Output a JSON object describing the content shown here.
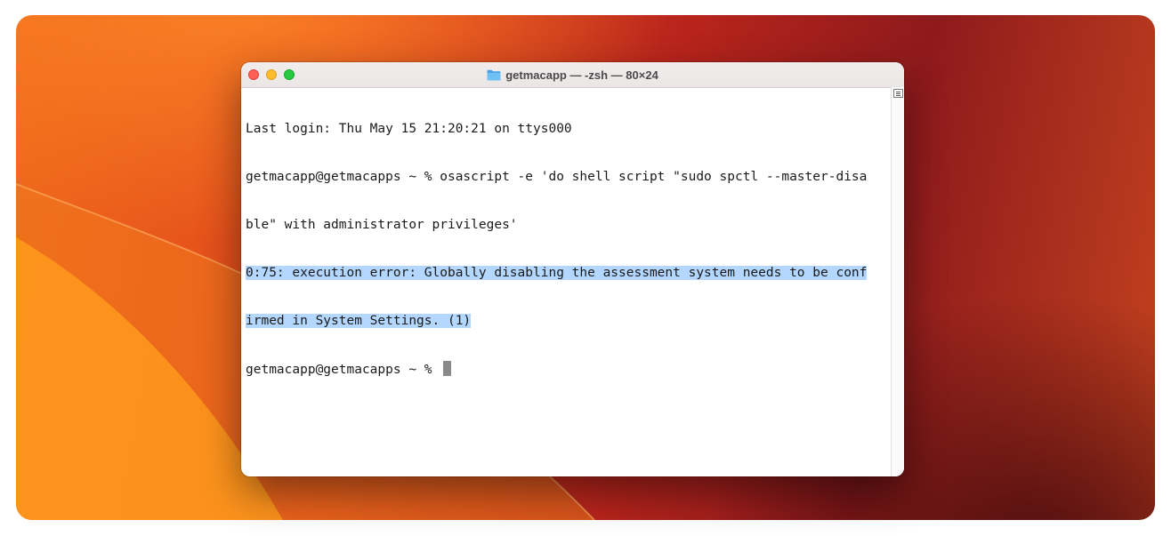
{
  "window": {
    "title": "getmacapp — -zsh — 80×24",
    "folder_icon": "folder-icon",
    "accent_close": "#fe5f57",
    "accent_minimize": "#febc2e",
    "accent_maximize": "#28c840"
  },
  "terminal": {
    "lines": [
      "Last login: Thu May 15 21:20:21 on ttys000",
      "getmacapp@getmacapps ~ % osascript -e 'do shell script \"sudo spctl --master-disa",
      "ble\" with administrator privileges'",
      "0:75: execution error: Globally disabling the assessment system needs to be conf",
      "irmed in System Settings. (1)",
      "getmacapp@getmacapps ~ % "
    ],
    "selection_color": "#b3d7ff"
  }
}
